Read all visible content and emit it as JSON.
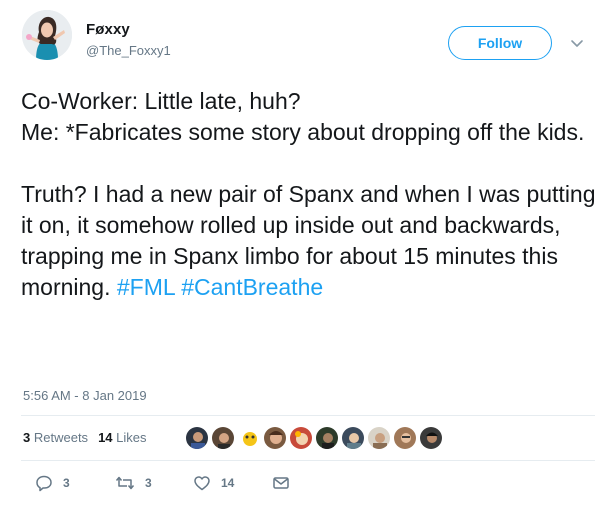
{
  "author": {
    "display_name": "Føxxy",
    "handle": "@The_Foxxy1"
  },
  "follow_button": {
    "label": "Follow"
  },
  "tweet": {
    "lines": [
      "Co-Worker: Little late, huh?",
      "Me: *Fabricates some story about dropping off the kids."
    ],
    "paragraph2": "Truth? I had a new pair of Spanx and when I was putting it on, it somehow rolled up inside out and backwards, trapping me in Spanx limbo for about 15 minutes this morning.",
    "hashtags": [
      "#FML",
      "#CantBreathe"
    ]
  },
  "timestamp": "5:56 AM - 8 Jan 2019",
  "stats": {
    "retweets_count": "3",
    "retweets_label": "Retweets",
    "likes_count": "14",
    "likes_label": "Likes"
  },
  "likers_count_shown": 10,
  "actions": {
    "reply_count": "3",
    "retweet_count": "3",
    "like_count": "14"
  },
  "colors": {
    "link_blue": "#1da1f2",
    "secondary_text": "#657786",
    "primary_text": "#14171a",
    "divider": "#e6ecf0"
  },
  "icons": [
    "caret-down-icon",
    "reply-icon",
    "retweet-icon",
    "heart-icon",
    "message-icon"
  ]
}
